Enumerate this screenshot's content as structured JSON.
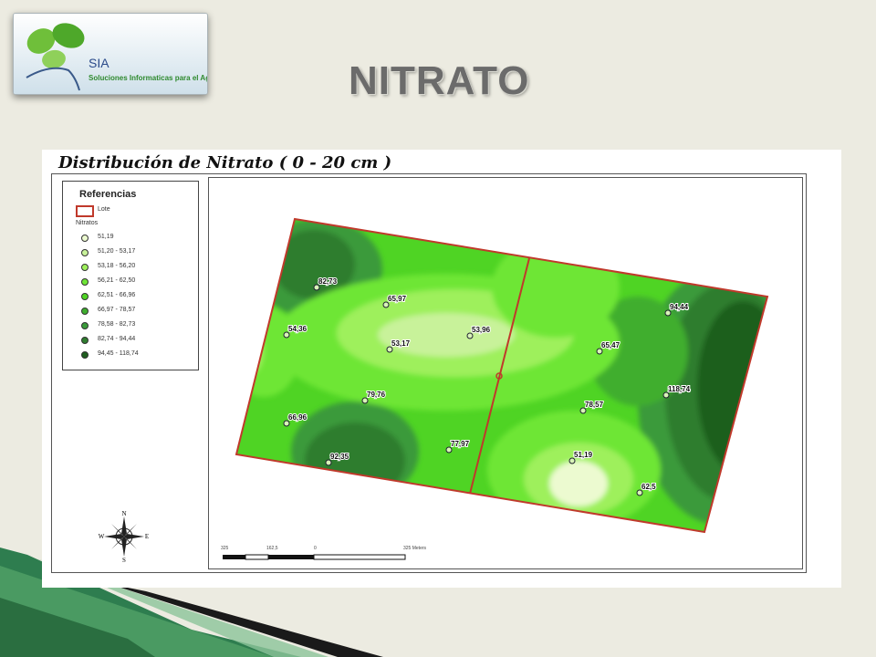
{
  "slide": {
    "title": "NITRATO"
  },
  "logo": {
    "name": "SIA",
    "tagline": "Soluciones Informaticas para el Agro"
  },
  "map": {
    "title": "Distribución de Nitrato ( 0 - 20 cm )",
    "legend": {
      "title": "Referencias",
      "lote_label": "Lote",
      "nitratos_label": "Nitratos",
      "classes": [
        {
          "label": "51,19",
          "color": "#ecfad0"
        },
        {
          "label": "51,20 - 53,17",
          "color": "#c8f29a"
        },
        {
          "label": "53,18 - 56,20",
          "color": "#9ef05c"
        },
        {
          "label": "56,21 - 62,50",
          "color": "#6ee636"
        },
        {
          "label": "62,51 - 66,96",
          "color": "#4fd424"
        },
        {
          "label": "66,97 - 78,57",
          "color": "#3fae2e"
        },
        {
          "label": "78,58 - 82,73",
          "color": "#3a9a3a"
        },
        {
          "label": "82,74 - 94,44",
          "color": "#2f7d2f"
        },
        {
          "label": "94,45 - 118,74",
          "color": "#1f5e1f"
        }
      ]
    },
    "points": [
      {
        "label": "82,73"
      },
      {
        "label": "65,97"
      },
      {
        "label": "54,36"
      },
      {
        "label": "53,17"
      },
      {
        "label": "53,96"
      },
      {
        "label": "65,47"
      },
      {
        "label": "94,44"
      },
      {
        "label": "118,74"
      },
      {
        "label": "79,76"
      },
      {
        "label": "78,57"
      },
      {
        "label": "66,96"
      },
      {
        "label": "77,97"
      },
      {
        "label": "92,35"
      },
      {
        "label": "51,19"
      },
      {
        "label": "62,5"
      }
    ],
    "compass": {
      "n": "N",
      "s": "S",
      "e": "E",
      "w": "W"
    },
    "scale": {
      "labels": [
        "325",
        "162,5",
        "0",
        "325 Meters"
      ]
    },
    "boundary_color": "#c0392b"
  }
}
